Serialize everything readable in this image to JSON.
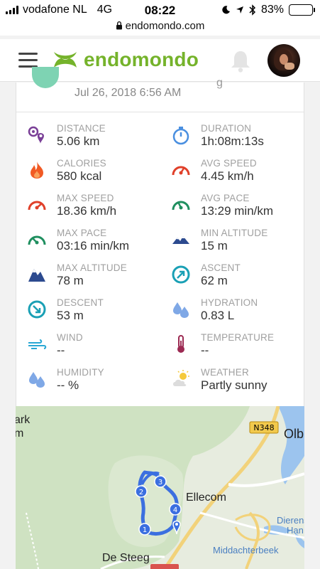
{
  "statusbar": {
    "carrier": "vodafone NL",
    "network": "4G",
    "time": "08:22",
    "battery": "83%",
    "battery_level": 0.83,
    "icons": [
      "moon-icon",
      "location-arrow-icon",
      "bluetooth-icon"
    ]
  },
  "browser": {
    "url": "endomondo.com"
  },
  "header": {
    "brand": "endomondo",
    "brand_color": "#75b32b"
  },
  "workout": {
    "date": "Jul 26, 2018 6:56 AM",
    "title_tail": "g"
  },
  "stats": [
    {
      "id": "distance",
      "label": "DISTANCE",
      "value": "5.06 km",
      "icon": "distance-icon"
    },
    {
      "id": "duration",
      "label": "DURATION",
      "value": "1h:08m:13s",
      "icon": "stopwatch-icon"
    },
    {
      "id": "calories",
      "label": "CALORIES",
      "value": "580 kcal",
      "icon": "flame-icon"
    },
    {
      "id": "avg-speed",
      "label": "AVG SPEED",
      "value": "4.45 km/h",
      "icon": "speedometer-icon"
    },
    {
      "id": "max-speed",
      "label": "MAX SPEED",
      "value": "18.36 km/h",
      "icon": "speedometer-icon"
    },
    {
      "id": "avg-pace",
      "label": "AVG PACE",
      "value": "13:29 min/km",
      "icon": "pace-gauge-icon"
    },
    {
      "id": "max-pace",
      "label": "MAX PACE",
      "value": "03:16 min/km",
      "icon": "pace-gauge-icon"
    },
    {
      "id": "min-altitude",
      "label": "MIN ALTITUDE",
      "value": "15 m",
      "icon": "low-mountain-icon"
    },
    {
      "id": "max-altitude",
      "label": "MAX ALTITUDE",
      "value": "78 m",
      "icon": "mountain-icon"
    },
    {
      "id": "ascent",
      "label": "ASCENT",
      "value": "62 m",
      "icon": "ascent-arrow-icon"
    },
    {
      "id": "descent",
      "label": "DESCENT",
      "value": "53 m",
      "icon": "descent-arrow-icon"
    },
    {
      "id": "hydration",
      "label": "HYDRATION",
      "value": "0.83 L",
      "icon": "water-drops-icon"
    },
    {
      "id": "wind",
      "label": "WIND",
      "value": "--",
      "icon": "wind-icon"
    },
    {
      "id": "temperature",
      "label": "TEMPERATURE",
      "value": "--",
      "icon": "thermometer-icon"
    },
    {
      "id": "humidity",
      "label": "HUMIDITY",
      "value": "-- %",
      "icon": "humidity-drops-icon"
    },
    {
      "id": "weather",
      "label": "WEATHER",
      "value": "Partly sunny",
      "icon": "partly-sunny-icon"
    }
  ],
  "map": {
    "labels": {
      "park_a": "ark",
      "park_b": "m",
      "road": "N348",
      "olb": "Olb",
      "ellecom": "Ellecom",
      "dierens": "Dierens",
      "han": "Han",
      "middachterbeek": "Middachterbeek",
      "desteeg": "De Steeg"
    },
    "markers": [
      "1",
      "2",
      "3",
      "4"
    ],
    "route_color": "#3b6fe0"
  }
}
